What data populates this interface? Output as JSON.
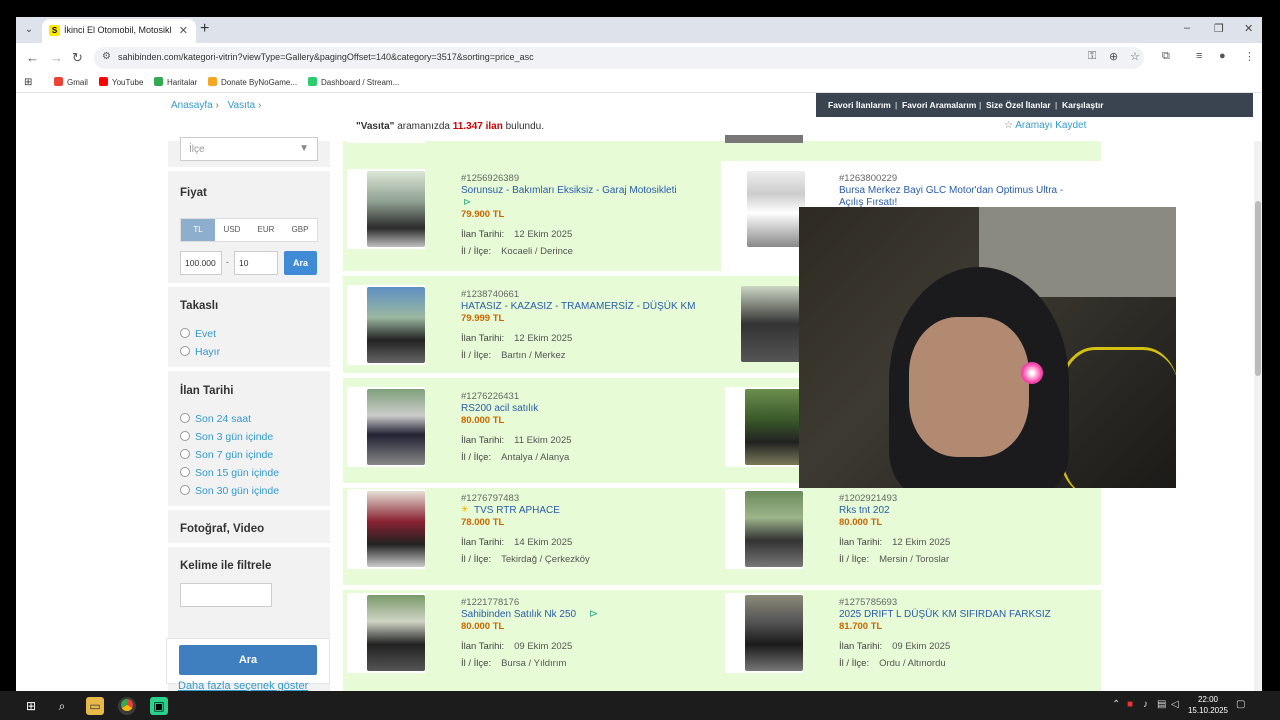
{
  "browser": {
    "tab_title": "İkinci El Otomobil, Motosiklet",
    "favicon": "S",
    "url": "sahibinden.com/kategori-vitrin?viewType=Gallery&pagingOffset=140&category=3517&sorting=price_asc"
  },
  "bookmarks": [
    {
      "label": "Gmail",
      "color": "#ea4335"
    },
    {
      "label": "YouTube",
      "color": "#ff0000"
    },
    {
      "label": "Haritalar",
      "color": "#34a853"
    },
    {
      "label": "Donate ByNoGame...",
      "color": "#f5a623"
    },
    {
      "label": "Dashboard / Stream...",
      "color": "#2ecc71"
    }
  ],
  "breadcrumb": {
    "home": "Anasayfa",
    "sep1": "›",
    "cat": "Vasıta",
    "sep2": "›"
  },
  "topnav": [
    "Favori İlanlarım",
    "|",
    "Favori Aramalarım",
    "|",
    "Size Özel İlanlar",
    "|",
    "Karşılaştır"
  ],
  "results": {
    "query": "\"Vasıta\"",
    "mid": "aramanızda",
    "count": "11.347 ilan",
    "end": "bulundu."
  },
  "save_search": "Aramayı Kaydet",
  "sidebar": {
    "ilce_placeholder": "İlçe",
    "fiyat": "Fiyat",
    "currencies": [
      "TL",
      "USD",
      "EUR",
      "GBP"
    ],
    "price_min": "100.000",
    "price_sep": "-",
    "price_max": "10",
    "price_btn": "Ara",
    "takasli": "Takaslı",
    "takasli_opts": [
      "Evet",
      "Hayır"
    ],
    "ilan_tarihi": "İlan Tarihi",
    "date_opts": [
      "Son 24 saat",
      "Son 3 gün içinde",
      "Son 7 gün içinde",
      "Son 15 gün içinde",
      "Son 30 gün içinde"
    ],
    "foto": "Fotoğraf, Video",
    "keyword": "Kelime ile filtrele",
    "search_btn": "Ara",
    "more": "Daha fazla seçenek göster"
  },
  "listings_left": [
    {
      "id": "#1256926389",
      "title": "Sorunsuz - Bakımları Eksiksiz - Garaj Motosikleti",
      "price": "79.900 TL",
      "date": "12 Ekim 2025",
      "loc": "Kocaeli / Derince"
    },
    {
      "id": "#1238740661",
      "title": "HATASIZ - KAZASIZ - TRAMAMERSİZ - DÜŞÜK KM",
      "price": "79.999 TL",
      "date": "12 Ekim 2025",
      "loc": "Bartın / Merkez"
    },
    {
      "id": "#1276226431",
      "title": "RS200 acil satılık",
      "price": "80.000 TL",
      "date": "11 Ekim 2025",
      "loc": "Antalya / Alanya"
    },
    {
      "id": "#1276797483",
      "title": "TVS RTR APHACE",
      "price": "78.000 TL",
      "date": "14 Ekim 2025",
      "loc": "Tekirdağ / Çerkezköy"
    },
    {
      "id": "#1221778176",
      "title": "Sahibinden Satılık Nk 250",
      "price": "80.000 TL",
      "date": "09 Ekim 2025",
      "loc": "Bursa / Yıldırım"
    }
  ],
  "listings_right": [
    {
      "id": "#1263800229",
      "title": "Bursa Merkez Bayi GLC Motor'dan Optimus Ultra -",
      "title2": "Açılış Fırsatı!",
      "price": "",
      "date": "",
      "loc": ""
    },
    {
      "id": "#1202921493",
      "title": "Rks tnt 202",
      "price": "80.000 TL",
      "date": "12 Ekim 2025",
      "loc": "Mersin / Toroslar"
    },
    {
      "id": "#1275785693",
      "title": "2025 DRIFT L DÜŞÜK KM SIFIRDAN FARKSIZ",
      "price": "81.700 TL",
      "date": "09 Ekim 2025",
      "loc": "Ordu / Altınordu"
    }
  ],
  "labels": {
    "date_label": "İlan Tarihi:",
    "loc_label": "İl / İlçe:"
  },
  "clock": {
    "time": "22:00",
    "date": "15.10.2025"
  }
}
